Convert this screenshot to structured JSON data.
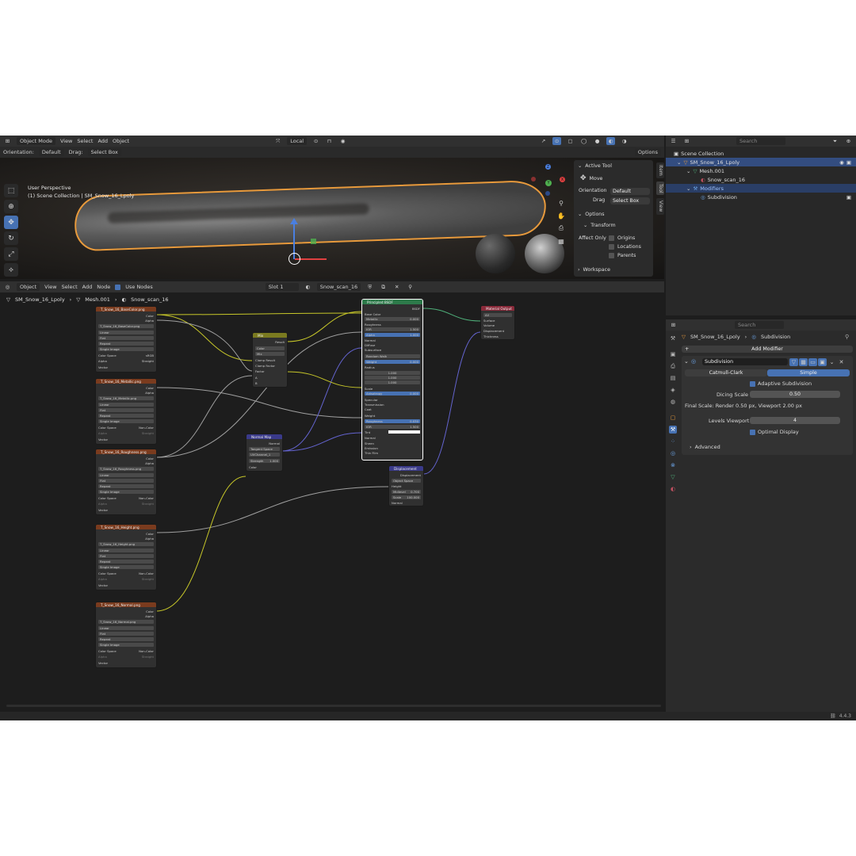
{
  "viewport_header": {
    "mode": "Object Mode",
    "menus": [
      "View",
      "Select",
      "Add",
      "Object"
    ],
    "transform_space": "Local",
    "orientation_label": "Orientation:",
    "orientation_value": "Default",
    "drag_label": "Drag:",
    "drag_value": "Select Box",
    "options": "Options"
  },
  "viewport": {
    "perspective": "User Perspective",
    "collection": "(1) Scene Collection | SM_Snow_16_Lpoly"
  },
  "npanel": {
    "tabs": [
      "Item",
      "Tool",
      "View"
    ],
    "active_tool_title": "Active Tool",
    "tool_name": "Move",
    "orientation_label": "Orientation",
    "orientation_value": "Default",
    "drag_label": "Drag",
    "drag_value": "Select Box",
    "options_title": "Options",
    "transform_title": "Transform",
    "affect_only_label": "Affect Only",
    "affect_items": [
      "Origins",
      "Locations",
      "Parents"
    ],
    "workspace_title": "Workspace"
  },
  "outliner": {
    "search_placeholder": "Search",
    "rows": [
      {
        "label": "Scene Collection",
        "indent": 0
      },
      {
        "label": "SM_Snow_16_Lpoly",
        "indent": 1
      },
      {
        "label": "Mesh.001",
        "indent": 2
      },
      {
        "label": "Snow_scan_16",
        "indent": 3
      },
      {
        "label": "Modifiers",
        "indent": 2
      },
      {
        "label": "Subdivision",
        "indent": 3
      }
    ]
  },
  "node_header": {
    "editor": "Object",
    "menus": [
      "View",
      "Select",
      "Add",
      "Node"
    ],
    "use_nodes": "Use Nodes",
    "slot": "Slot 1",
    "material": "Snow_scan_16"
  },
  "breadcrumb": [
    "SM_Snow_16_Lpoly",
    "Mesh.001",
    "Snow_scan_16"
  ],
  "nodes": {
    "tex_basecolor": "T_Snow_16_BaseColor.png",
    "tex_metallic": "T_Snow_16_Metallic.png",
    "tex_roughness": "T_Snow_16_Roughness.png",
    "tex_height": "T_Snow_16_Height.png",
    "tex_normal": "T_Snow_16_Normal.png",
    "tex_rows": [
      "Linear",
      "Flat",
      "Repeat",
      "Single Image"
    ],
    "color_space_label": "Color Space",
    "srgb": "sRGB",
    "noncolor": "Non-Color",
    "alpha_label": "Alpha",
    "straight": "Straight",
    "color_out": "Color",
    "alpha_out": "Alpha",
    "vector_in": "Vector",
    "mix_title": "Mix",
    "mix_rows": [
      "Result",
      "Color",
      "Mix",
      "Clamp Result",
      "Clamp Factor",
      "Factor",
      "A",
      "B"
    ],
    "normal_map_title": "Normal Map",
    "normal_map_rows": [
      "Normal",
      "Tangent Space",
      "UVChannel_1",
      "Strength",
      "1.000",
      "Color"
    ],
    "bsdf_title": "Principled BSDF",
    "bsdf_out": "BSDF",
    "bsdf_rows": [
      "Base Color",
      "Metallic",
      "0.000",
      "Roughness",
      "IOR",
      "1.500",
      "Alpha",
      "1.000",
      "Normal",
      "Diffuse",
      "Subsurface",
      "Random Walk",
      "Weight",
      "0.000",
      "Radius",
      "1.000",
      "1.000",
      "1.000",
      "Scale",
      "Anisotropy",
      "0.000",
      "Specular",
      "Transmission",
      "Coat",
      "Weight",
      "Roughness",
      "0.030",
      "IOR",
      "1.500",
      "Tint",
      "Normal",
      "Sheen",
      "Emission",
      "Thin Film"
    ],
    "output_title": "Material Output",
    "output_rows": [
      "All",
      "Surface",
      "Volume",
      "Displacement",
      "Thickness"
    ],
    "disp_title": "Displacement",
    "disp_rows": [
      "Displacement",
      "Object Space",
      "Height",
      "Midlevel",
      "0.700",
      "Scale",
      "100.000",
      "Normal"
    ]
  },
  "props": {
    "search_placeholder": "Search",
    "object": "SM_Snow_16_Lpoly",
    "modifier_crumb": "Subdivision",
    "add_modifier": "Add Modifier",
    "modifier_name": "Subdivision",
    "mode_catmull": "Catmull-Clark",
    "mode_simple": "Simple",
    "adaptive": "Adaptive Subdivision",
    "dicing_label": "Dicing Scale",
    "dicing_value": "0.50",
    "final_scale": "Final Scale: Render 0.50 px, Viewport 2.00 px",
    "levels_label": "Levels Viewport",
    "levels_value": "4",
    "optimal": "Optimal Display",
    "advanced": "Advanced"
  },
  "version": "4.4.3",
  "colors": {
    "accent": "#4772b3",
    "selection": "#e89a3c",
    "texture_header": "#7a3b1e",
    "shader_header": "#2d7a4a",
    "vector_header": "#3a3a8a"
  }
}
